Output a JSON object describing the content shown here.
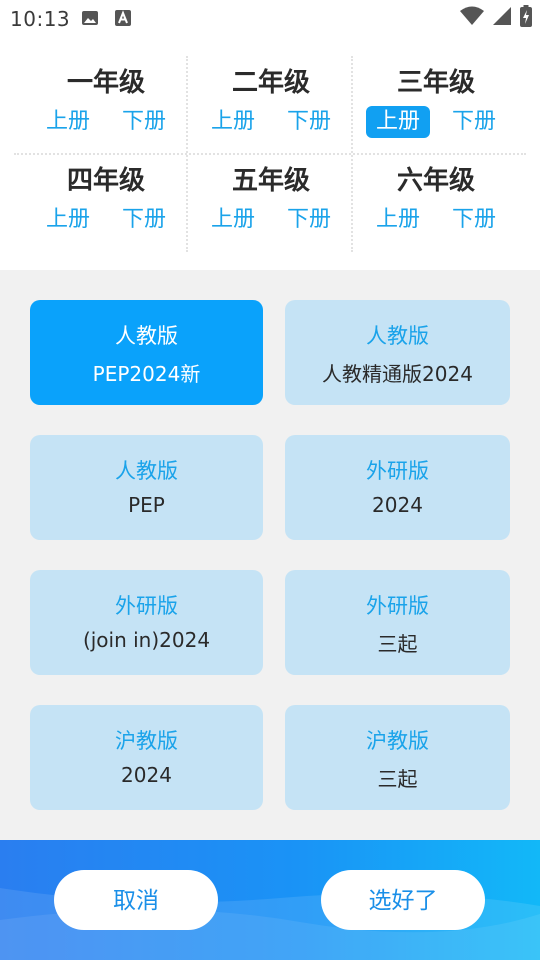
{
  "status_bar": {
    "time": "10:13",
    "left_icons": [
      "image-icon",
      "a-text-icon"
    ],
    "right_icons": [
      "wifi-icon",
      "signal-icon",
      "battery-charging-icon"
    ]
  },
  "grades": [
    {
      "title": "一年级",
      "upper": "上册",
      "lower": "下册",
      "selected": ""
    },
    {
      "title": "二年级",
      "upper": "上册",
      "lower": "下册",
      "selected": ""
    },
    {
      "title": "三年级",
      "upper": "上册",
      "lower": "下册",
      "selected": "upper"
    },
    {
      "title": "四年级",
      "upper": "上册",
      "lower": "下册",
      "selected": ""
    },
    {
      "title": "五年级",
      "upper": "上册",
      "lower": "下册",
      "selected": ""
    },
    {
      "title": "六年级",
      "upper": "上册",
      "lower": "下册",
      "selected": ""
    }
  ],
  "editions": [
    {
      "name": "人教版",
      "sub": "PEP2024新",
      "selected": true
    },
    {
      "name": "人教版",
      "sub": "人教精通版2024",
      "selected": false
    },
    {
      "name": "人教版",
      "sub": "PEP",
      "selected": false
    },
    {
      "name": "外研版",
      "sub": "2024",
      "selected": false
    },
    {
      "name": "外研版",
      "sub": "(join in)2024",
      "selected": false
    },
    {
      "name": "外研版",
      "sub": "三起",
      "selected": false
    },
    {
      "name": "沪教版",
      "sub": "2024",
      "selected": false
    },
    {
      "name": "沪教版",
      "sub": "三起",
      "selected": false
    }
  ],
  "footer": {
    "cancel_label": "取消",
    "confirm_label": "选好了"
  },
  "colors": {
    "accent": "#11a0f2",
    "card_bg": "#c5e3f5",
    "card_active": "#0aa2fb",
    "footer_start": "#2a7ef0",
    "footer_end": "#12b8f8"
  }
}
